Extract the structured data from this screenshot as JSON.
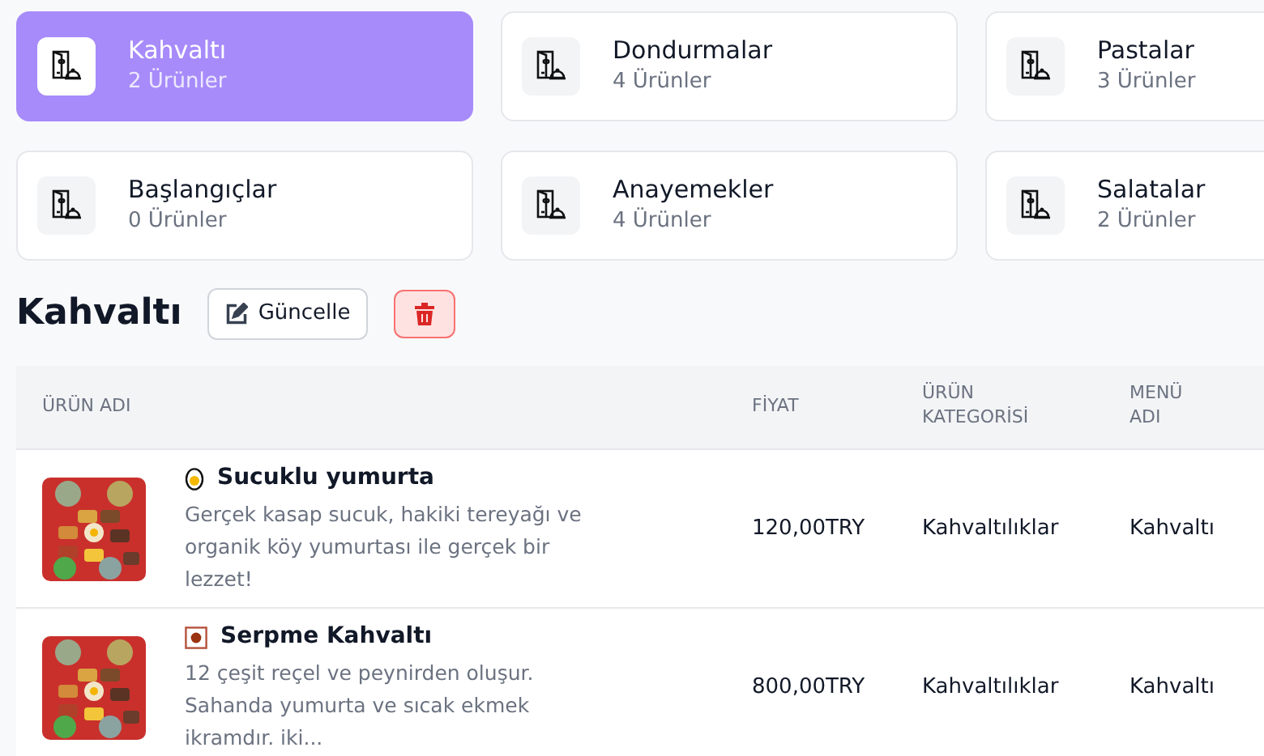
{
  "categories": [
    {
      "name": "Kahvaltı",
      "count": "2 Ürünler",
      "selected": true
    },
    {
      "name": "Dondurmalar",
      "count": "4 Ürünler",
      "selected": false
    },
    {
      "name": "Pastalar",
      "count": "3 Ürünler",
      "selected": false
    },
    {
      "name": "Başlangıçlar",
      "count": "0 Ürünler",
      "selected": false
    },
    {
      "name": "Anayemekler",
      "count": "4 Ürünler",
      "selected": false
    },
    {
      "name": "Salatalar",
      "count": "2 Ürünler",
      "selected": false
    }
  ],
  "menu": {
    "title": "Kahvaltı",
    "edit_button": "Güncelle"
  },
  "table": {
    "columns": [
      "ÜRÜN ADI",
      "FİYAT",
      "ÜRÜN KATEGORİSİ",
      "MENÜ ADI"
    ],
    "rows": [
      {
        "kind": "egg",
        "name": "Sucuklu yumurta",
        "description": "Gerçek kasap sucuk, hakiki tereyağı ve organik köy yumurtası ile gerçek bir lezzet!",
        "price": "120,00TRY",
        "category": "Kahvaltılıklar",
        "menu": "Kahvaltı"
      },
      {
        "kind": "dot-square",
        "name": "Serpme Kahvaltı",
        "description": "12 çeşit reçel ve peynirden oluşur. Sahanda yumurta ve sıcak ekmek ikramdır. iki...",
        "price": "800,00TRY",
        "category": "Kahvaltılıklar",
        "menu": "Kahvaltı"
      }
    ]
  }
}
